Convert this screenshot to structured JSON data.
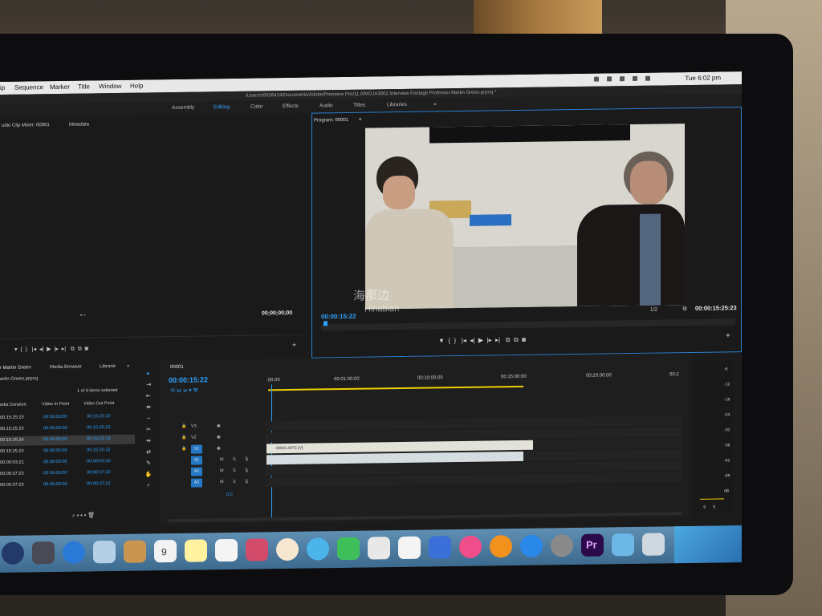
{
  "menubar": {
    "items": [
      "ip",
      "Sequence",
      "Marker",
      "Title",
      "Window",
      "Help"
    ],
    "clock": "Tue 6:02 pm"
  },
  "path_title": "/Users/s5026413/Documents/Adobe/Premiere Pro/11.0/MOJA3002 Interview Footage Professor Martin Green.prproj *",
  "workspaces": [
    "Assembly",
    "Editing",
    "Color",
    "Effects",
    "Audio",
    "Titles",
    "Libraries",
    "»"
  ],
  "source_panel": {
    "tabs": [
      "udio Clip Mixer: 00001",
      "Metadata"
    ],
    "timecode": "00;00;00;00"
  },
  "program": {
    "title": "Program: 00001",
    "timecode_in": "00:00:15:22",
    "timecode_out": "00:00:15:25:23",
    "resolution": "1/2",
    "watermark_cn": "海那边",
    "watermark_en": "Hinabian"
  },
  "project": {
    "tabs": [
      "r Martin Green",
      "Media Browser",
      "Librarie",
      "»"
    ],
    "file": "artin Green.prproj",
    "items_selected": "1 of 9 items selected",
    "columns": [
      "edia Duration",
      "Video In Point",
      "Video Out Point"
    ],
    "rows": [
      [
        "00:15:25:23",
        "00:00:00:00",
        "00:15:25:22"
      ],
      [
        "00:15:25:23",
        "00:00:00:00",
        "00:15:25:22"
      ],
      [
        "00:15:25:24",
        "00:00:00:00",
        "00:15:25:23"
      ],
      [
        "00:15:25:23",
        "00:00:00:00",
        "00:15:25:22"
      ],
      [
        "00:00:03:21",
        "00:00:00:00",
        "00:00:03:20"
      ],
      [
        "00:00:37:23",
        "00:00:00:00",
        "00:00:37:22"
      ],
      [
        "00:00:37:23",
        "00:00:00:00",
        "00:00:37:22"
      ]
    ]
  },
  "timeline": {
    "tab": "00001",
    "timecode": "00:00:15:22",
    "ruler": [
      ":00:00",
      "00:01:00:00",
      "00:10:00:00",
      "00:15:00:00",
      "00:20:00:00",
      "00:2"
    ],
    "video_tracks": [
      "V3",
      "V2",
      "V1"
    ],
    "audio_tracks": [
      "A1",
      "A2",
      "A3"
    ],
    "track_buttons": [
      "M",
      "S"
    ],
    "master_value": "0.0",
    "clip_label": "00001.MTS [V]"
  },
  "meter_scale": [
    "-6",
    "-12",
    "-18",
    "-24",
    "-30",
    "-36",
    "-42",
    "-48",
    "dB"
  ],
  "meter_footer": [
    "S",
    "S"
  ],
  "dock_apps": [
    "Siri",
    "Launchpad",
    "Safari",
    "Preview",
    "Contacts",
    "Calendar",
    "Notes",
    "Reminders",
    "Photo Booth",
    "Photos",
    "Messages",
    "FaceTime",
    "Keynote",
    "Numbers",
    "Keynote Podium",
    "iTunes",
    "iBooks",
    "App Store",
    "System Preferences",
    "Pr",
    "Finder Folder",
    "Trash"
  ],
  "calendar_day": "9",
  "colors": {
    "accent": "#2ea3ff",
    "premiere": "#2a0a4a",
    "track_target": "#2478c4",
    "playhead_yellow": "#f0d000"
  }
}
